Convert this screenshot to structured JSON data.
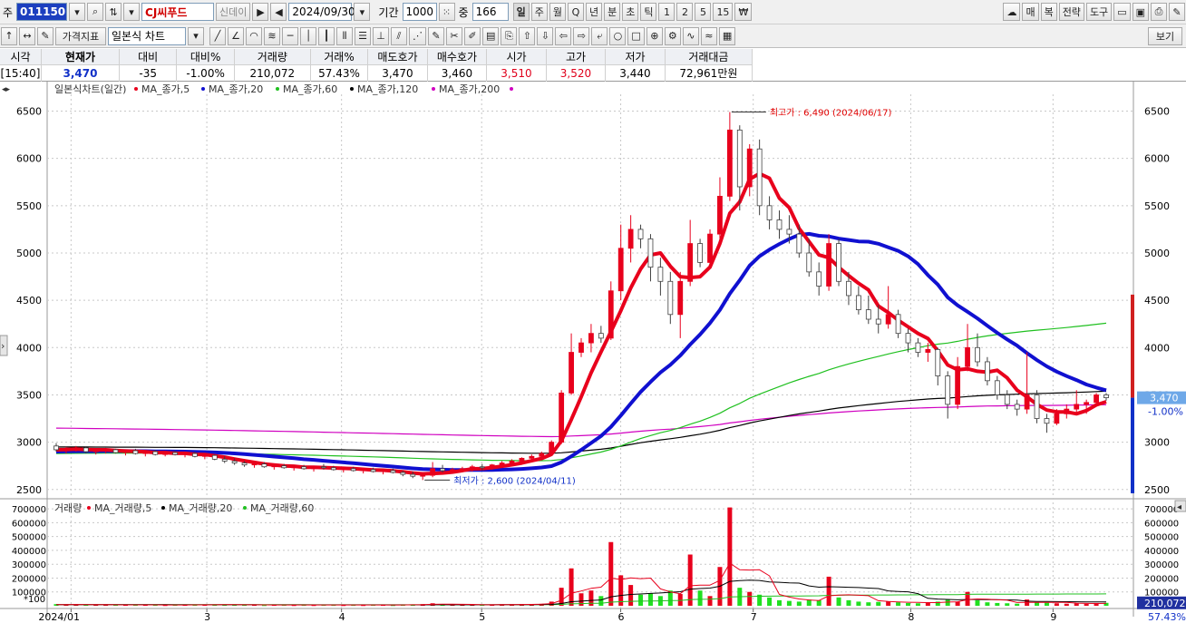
{
  "toolbar1": {
    "market_label": "주",
    "stock_code": "011150",
    "stock_name": "CJ씨푸드",
    "badge_label": "신데이",
    "date": "2024/09/30",
    "period_label": "기간",
    "period_value": "1000",
    "count_label": "중",
    "count_value": "166",
    "timeframes": [
      "일",
      "주",
      "월",
      "Q",
      "년",
      "분",
      "초",
      "틱",
      "1",
      "2",
      "5",
      "15",
      "₩"
    ],
    "active_timeframe": "일",
    "right_buttons": [
      "매",
      "복",
      "전략",
      "도구"
    ]
  },
  "toolbar2": {
    "indicator_button": "가격지표",
    "chart_type": "일본식 차트",
    "view_button": "보기"
  },
  "quote": {
    "headers": [
      "시각",
      "현재가",
      "대비",
      "대비%",
      "거래량",
      "거래%",
      "매도호가",
      "매수호가",
      "시가",
      "고가",
      "저가",
      "거래대금"
    ],
    "values": [
      "[15:40]",
      "3,470",
      "-35",
      "-1.00%",
      "210,072",
      "57.43%",
      "3,470",
      "3,460",
      "3,510",
      "3,520",
      "3,440",
      "72,961만원"
    ]
  },
  "chart_data": {
    "type": "candlestick",
    "price_legend": {
      "title": "일본식차트(일간)",
      "items": [
        {
          "name": "MA_종가,5",
          "color": "#e8001c"
        },
        {
          "name": "MA_종가,20",
          "color": "#1010d0"
        },
        {
          "name": "MA_종가,60",
          "color": "#20c020"
        },
        {
          "name": "MA_종가,120",
          "color": "#000000"
        },
        {
          "name": "MA_종가,200",
          "color": "#d000c0"
        }
      ]
    },
    "volume_legend": {
      "title": "거래량",
      "items": [
        {
          "name": "MA_거래량,5",
          "color": "#e8001c"
        },
        {
          "name": "MA_거래량,20",
          "color": "#000000"
        },
        {
          "name": "MA_거래량,60",
          "color": "#20c020"
        }
      ]
    },
    "price_ticks": [
      6500,
      6000,
      5500,
      5000,
      4500,
      4000,
      3500,
      3000,
      2500
    ],
    "volume_ticks": [
      700000,
      600000,
      500000,
      400000,
      300000,
      200000,
      100000
    ],
    "volume_unit": "*100",
    "x_labels": [
      {
        "label": "2024/01",
        "t": 0.022
      },
      {
        "label": "3",
        "t": 0.147
      },
      {
        "label": "4",
        "t": 0.271
      },
      {
        "label": "5",
        "t": 0.4
      },
      {
        "label": "6",
        "t": 0.528
      },
      {
        "label": "7",
        "t": 0.65
      },
      {
        "label": "8",
        "t": 0.795
      },
      {
        "label": "9",
        "t": 0.926
      }
    ],
    "ylim": [
      2450,
      6620
    ],
    "vol_ylim": [
      0,
      740000
    ],
    "current_price": "3,470",
    "current_change": "-1.00%",
    "current_volume": "210,072",
    "current_volume_pct": "57.43%",
    "high_annotation": "최고가 : 6,490 (2024/06/17)",
    "low_annotation": "최저가 : 2,600 (2024/04/11)",
    "high_value": 6490,
    "low_value": 2600,
    "candles": [
      [
        2960,
        2990,
        2900,
        2920
      ],
      [
        2920,
        2950,
        2880,
        2930
      ],
      [
        2930,
        2960,
        2900,
        2940
      ],
      [
        2940,
        2950,
        2880,
        2900
      ],
      [
        2900,
        2930,
        2870,
        2910
      ],
      [
        2910,
        2940,
        2880,
        2920
      ],
      [
        2920,
        2930,
        2880,
        2890
      ],
      [
        2890,
        2920,
        2860,
        2910
      ],
      [
        2910,
        2930,
        2870,
        2880
      ],
      [
        2880,
        2910,
        2850,
        2900
      ],
      [
        2900,
        2920,
        2860,
        2870
      ],
      [
        2870,
        2900,
        2850,
        2890
      ],
      [
        2890,
        2910,
        2860,
        2870
      ],
      [
        2870,
        2900,
        2840,
        2880
      ],
      [
        2880,
        2900,
        2840,
        2850
      ],
      [
        2850,
        2880,
        2820,
        2860
      ],
      [
        2860,
        2870,
        2810,
        2820
      ],
      [
        2820,
        2850,
        2780,
        2800
      ],
      [
        2800,
        2830,
        2760,
        2780
      ],
      [
        2780,
        2800,
        2740,
        2760
      ],
      [
        2760,
        2790,
        2730,
        2770
      ],
      [
        2770,
        2790,
        2730,
        2740
      ],
      [
        2740,
        2770,
        2710,
        2750
      ],
      [
        2750,
        2770,
        2720,
        2730
      ],
      [
        2730,
        2760,
        2700,
        2740
      ],
      [
        2740,
        2760,
        2710,
        2720
      ],
      [
        2720,
        2750,
        2690,
        2740
      ],
      [
        2740,
        2770,
        2710,
        2730
      ],
      [
        2730,
        2750,
        2700,
        2710
      ],
      [
        2710,
        2740,
        2680,
        2720
      ],
      [
        2720,
        2740,
        2690,
        2700
      ],
      [
        2700,
        2730,
        2670,
        2710
      ],
      [
        2710,
        2730,
        2680,
        2690
      ],
      [
        2690,
        2720,
        2660,
        2700
      ],
      [
        2700,
        2720,
        2670,
        2680
      ],
      [
        2680,
        2700,
        2640,
        2660
      ],
      [
        2660,
        2690,
        2620,
        2640
      ],
      [
        2640,
        2680,
        2600,
        2650
      ],
      [
        2650,
        2790,
        2630,
        2720
      ],
      [
        2720,
        2760,
        2680,
        2700
      ],
      [
        2700,
        2730,
        2670,
        2710
      ],
      [
        2710,
        2740,
        2680,
        2720
      ],
      [
        2720,
        2760,
        2690,
        2740
      ],
      [
        2740,
        2770,
        2700,
        2730
      ],
      [
        2730,
        2770,
        2710,
        2760
      ],
      [
        2760,
        2800,
        2730,
        2780
      ],
      [
        2780,
        2820,
        2750,
        2800
      ],
      [
        2800,
        2840,
        2770,
        2830
      ],
      [
        2830,
        2870,
        2800,
        2850
      ],
      [
        2850,
        2900,
        2820,
        2880
      ],
      [
        2880,
        3020,
        2860,
        3000
      ],
      [
        3000,
        3550,
        2980,
        3520
      ],
      [
        3520,
        4150,
        3500,
        3950
      ],
      [
        3950,
        4100,
        3900,
        4050
      ],
      [
        4050,
        4250,
        3950,
        4150
      ],
      [
        4150,
        4230,
        4050,
        4100
      ],
      [
        4100,
        4700,
        4080,
        4600
      ],
      [
        4600,
        5300,
        4500,
        5050
      ],
      [
        5050,
        5400,
        4900,
        5250
      ],
      [
        5250,
        5300,
        5050,
        5150
      ],
      [
        5150,
        5200,
        4700,
        4850
      ],
      [
        4850,
        4950,
        4550,
        4700
      ],
      [
        4700,
        4800,
        4250,
        4350
      ],
      [
        4350,
        4800,
        4100,
        4700
      ],
      [
        4700,
        5350,
        4650,
        5100
      ],
      [
        5100,
        5150,
        4850,
        4900
      ],
      [
        4900,
        5250,
        4850,
        5200
      ],
      [
        5200,
        5800,
        5150,
        5600
      ],
      [
        5600,
        6490,
        5550,
        6300
      ],
      [
        6300,
        6350,
        5450,
        5700
      ],
      [
        5700,
        6150,
        5600,
        6100
      ],
      [
        6100,
        6200,
        5400,
        5500
      ],
      [
        5500,
        5600,
        5250,
        5350
      ],
      [
        5350,
        5450,
        5150,
        5250
      ],
      [
        5250,
        5400,
        5100,
        5200
      ],
      [
        5200,
        5300,
        4950,
        5000
      ],
      [
        5000,
        5150,
        4750,
        4800
      ],
      [
        4800,
        4900,
        4550,
        4650
      ],
      [
        4650,
        5200,
        4600,
        5100
      ],
      [
        5100,
        5150,
        4650,
        4700
      ],
      [
        4700,
        4800,
        4450,
        4550
      ],
      [
        4550,
        4650,
        4350,
        4400
      ],
      [
        4400,
        4550,
        4250,
        4300
      ],
      [
        4300,
        4450,
        4150,
        4250
      ],
      [
        4250,
        4650,
        4200,
        4350
      ],
      [
        4350,
        4400,
        4100,
        4150
      ],
      [
        4150,
        4200,
        3950,
        4050
      ],
      [
        4050,
        4100,
        3900,
        3950
      ],
      [
        3950,
        4050,
        3850,
        3980
      ],
      [
        3980,
        4000,
        3600,
        3700
      ],
      [
        3700,
        3750,
        3250,
        3400
      ],
      [
        3400,
        3900,
        3350,
        3800
      ],
      [
        3800,
        4250,
        3750,
        4000
      ],
      [
        4000,
        4150,
        3800,
        3850
      ],
      [
        3850,
        3900,
        3600,
        3650
      ],
      [
        3650,
        3700,
        3450,
        3500
      ],
      [
        3500,
        3550,
        3350,
        3400
      ],
      [
        3400,
        3450,
        3280,
        3350
      ],
      [
        3350,
        3950,
        3300,
        3500
      ],
      [
        3500,
        3550,
        3200,
        3250
      ],
      [
        3250,
        3300,
        3100,
        3200
      ],
      [
        3200,
        3350,
        3180,
        3300
      ],
      [
        3300,
        3400,
        3250,
        3350
      ],
      [
        3350,
        3550,
        3300,
        3400
      ],
      [
        3400,
        3450,
        3300,
        3420
      ],
      [
        3420,
        3520,
        3380,
        3500
      ],
      [
        3500,
        3520,
        3440,
        3470
      ]
    ],
    "volumes": [
      12000,
      8000,
      9000,
      7000,
      6000,
      8000,
      7000,
      6000,
      7000,
      6000,
      6000,
      5000,
      7000,
      6000,
      8000,
      7000,
      9000,
      8000,
      7000,
      6000,
      6000,
      5000,
      6000,
      7000,
      5000,
      6000,
      5000,
      7000,
      6000,
      5000,
      6000,
      5000,
      7000,
      6000,
      5000,
      8000,
      9000,
      12000,
      18000,
      9000,
      7000,
      6000,
      8000,
      7000,
      8000,
      9000,
      10000,
      11000,
      12000,
      14000,
      30000,
      130000,
      270000,
      90000,
      110000,
      70000,
      460000,
      220000,
      150000,
      80000,
      90000,
      70000,
      110000,
      85000,
      370000,
      110000,
      70000,
      280000,
      710000,
      130000,
      100000,
      80000,
      60000,
      40000,
      35000,
      30000,
      45000,
      40000,
      210000,
      60000,
      40000,
      30000,
      25000,
      28000,
      30000,
      25000,
      20000,
      18000,
      22000,
      30000,
      45000,
      30000,
      100000,
      40000,
      25000,
      20000,
      18000,
      15000,
      45000,
      25000,
      22000,
      18000,
      15000,
      16000,
      14000,
      20000,
      21007
    ]
  }
}
